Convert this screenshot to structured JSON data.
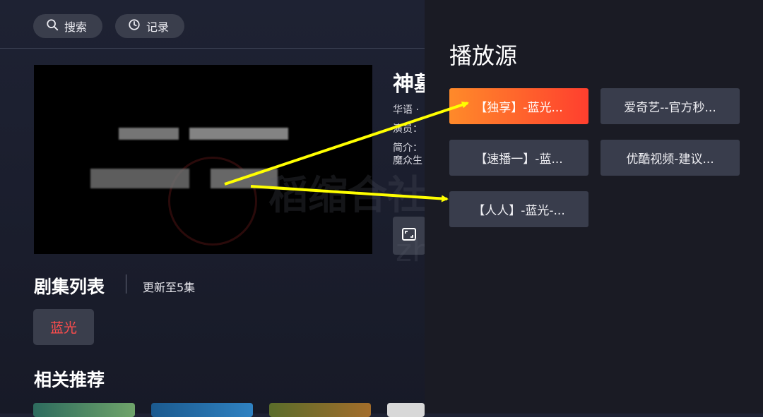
{
  "header": {
    "search_label": "搜索",
    "history_label": "记录"
  },
  "detail": {
    "title": "神墓",
    "language_line": "华语 · ",
    "cast_prefix": "演员：",
    "intro_prefix": "简介：",
    "intro_text": "魔众生"
  },
  "episodes": {
    "heading": "剧集列表",
    "update_text": "更新至5集",
    "quality_chip": "蓝光"
  },
  "related": {
    "heading": "相关推荐"
  },
  "source_panel": {
    "title": "播放源",
    "sources": [
      {
        "label": "【独享】-蓝光...",
        "active": true
      },
      {
        "label": "爱奇艺--官方秒...",
        "active": false
      },
      {
        "label": "【速播一】-蓝...",
        "active": false
      },
      {
        "label": "优酷视频-建议...",
        "active": false
      },
      {
        "label": "【人人】-蓝光-...",
        "active": false
      }
    ]
  },
  "watermark": {
    "text_cn": "稻缩合社区",
    "text_url": "zh.com"
  },
  "colors": {
    "accent_gradient_start": "#ff8a2a",
    "accent_gradient_end": "#ff3f2e",
    "chip_text": "#ff4d4d",
    "annotation_arrow": "#ffff00"
  },
  "icons": {
    "search": "search-icon",
    "history": "clock-icon",
    "fullscreen": "fullscreen-icon"
  }
}
